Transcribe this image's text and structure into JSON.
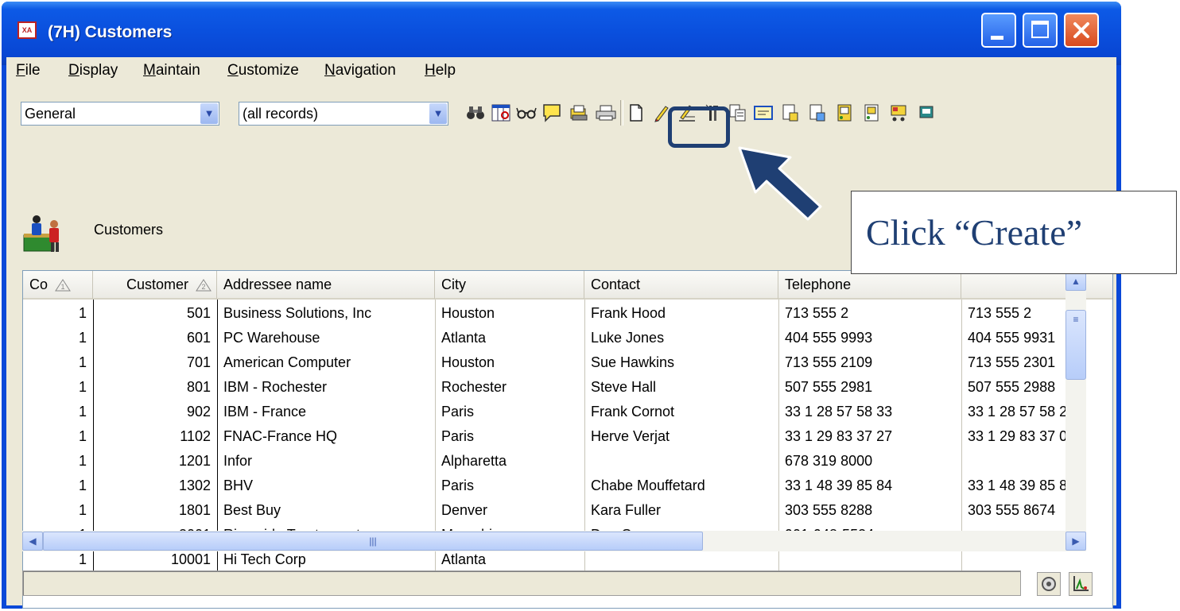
{
  "window": {
    "title": "(7H) Customers",
    "icon_text": "XA"
  },
  "menu": [
    {
      "label": "File",
      "acc": "F",
      "rest": "ile"
    },
    {
      "label": "Display",
      "acc": "D",
      "rest": "isplay"
    },
    {
      "label": "Maintain",
      "acc": "M",
      "rest": "aintain"
    },
    {
      "label": "Customize",
      "acc": "C",
      "rest": "ustomize"
    },
    {
      "label": "Navigation",
      "acc": "N",
      "rest": "avigation"
    },
    {
      "label": "Help",
      "acc": "H",
      "rest": "elp"
    }
  ],
  "toolbar": {
    "view_combo": "General",
    "subset_combo": "(all records)",
    "icons": [
      "find-icon",
      "column-view-icon",
      "glasses-icon",
      "note-icon",
      "print-set-icon",
      "printer-icon",
      "create-icon",
      "change-icon",
      "edit-icon",
      "tools-icon",
      "copy-icon",
      "card-icon",
      "document-icon",
      "document2-icon",
      "form-icon",
      "form2-icon",
      "cart-icon",
      "more-icon"
    ]
  },
  "view": {
    "label": "Customers"
  },
  "grid": {
    "columns": [
      "Co",
      "Customer",
      "Addressee name",
      "City",
      "Contact",
      "Telephone",
      ""
    ],
    "sort_badges": [
      "1",
      "2"
    ],
    "rows": [
      [
        "1",
        "501",
        "Business Solutions, Inc",
        "Houston",
        "Frank Hood",
        "713 555 2",
        "713 555 2"
      ],
      [
        "1",
        "601",
        "PC Warehouse",
        "Atlanta",
        "Luke Jones",
        "404 555 9993",
        "404 555 9931"
      ],
      [
        "1",
        "701",
        "American Computer",
        "Houston",
        "Sue Hawkins",
        "713 555 2109",
        "713 555 2301"
      ],
      [
        "1",
        "801",
        "IBM - Rochester",
        "Rochester",
        "Steve Hall",
        "507 555 2981",
        "507 555 2988"
      ],
      [
        "1",
        "902",
        "IBM - France",
        "Paris",
        "Frank Cornot",
        "33 1 28 57 58 33",
        "33 1 28 57 58 2"
      ],
      [
        "1",
        "1102",
        "FNAC-France HQ",
        "Paris",
        "Herve Verjat",
        "33 1 29 83 37 27",
        "33 1 29 83 37 0"
      ],
      [
        "1",
        "1201",
        "Infor",
        "Alpharetta",
        "",
        "678 319 8000",
        ""
      ],
      [
        "1",
        "1302",
        "BHV",
        "Paris",
        "Chabe Mouffetard",
        "33 1 48 39 85 84",
        "33 1 48 39 85 8"
      ],
      [
        "1",
        "1801",
        "Best Buy",
        "Denver",
        "Kara Fuller",
        "303 555 8288",
        "303 555 8674"
      ],
      [
        "1",
        "3001",
        "Riverside Tractor parts",
        "Memphis",
        "Don Greenop",
        "901-948-5534",
        ""
      ],
      [
        "1",
        "10001",
        "Hi Tech Corp",
        "Atlanta",
        "",
        "",
        ""
      ]
    ]
  },
  "callout": {
    "text": "Click “Create”"
  },
  "colors": {
    "highlight": "#1f3f73",
    "title_bar": "#0a4fdd"
  }
}
